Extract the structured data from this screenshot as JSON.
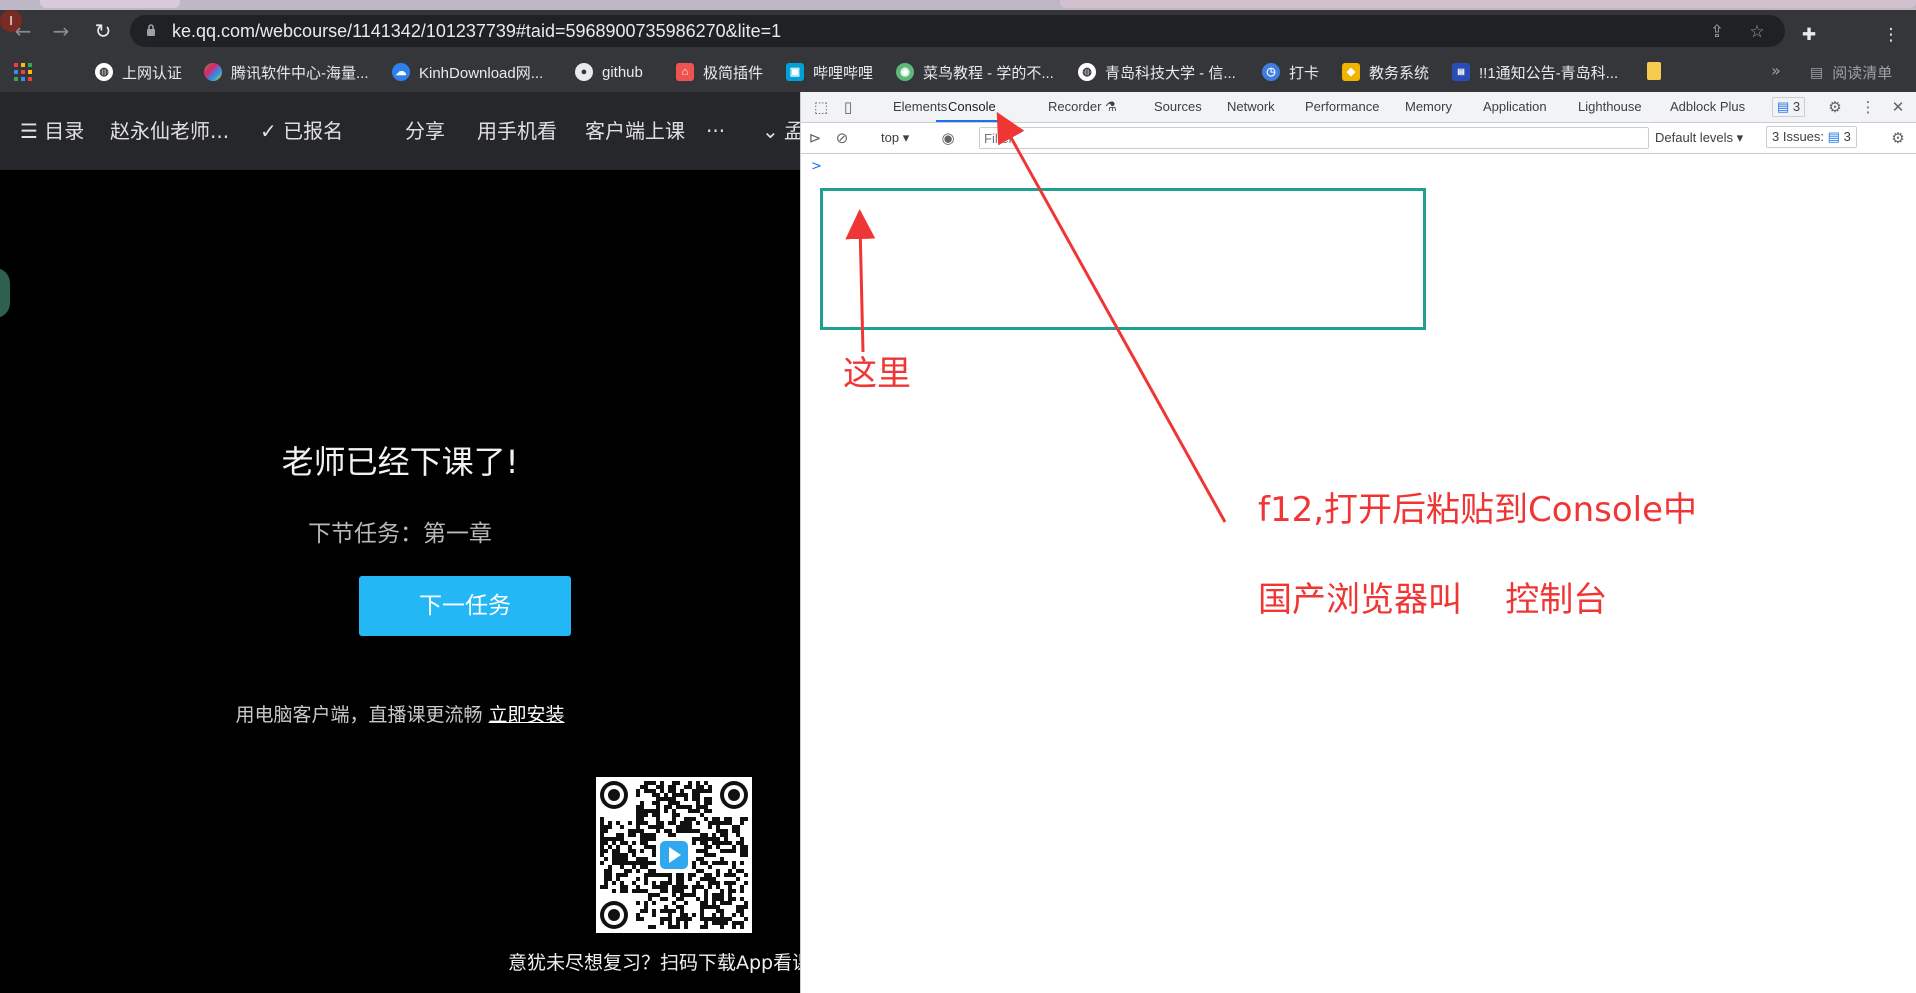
{
  "browser": {
    "url": "ke.qq.com/webcourse/1141342/101237739#taid=5968900735986270&lite=1",
    "profile_initial": "I",
    "bookmarks": [
      {
        "label": "上网认证",
        "icon": "globe-icon",
        "color": "#ffffff"
      },
      {
        "label": "腾讯软件中心-海量...",
        "icon": "clover-icon",
        "color": "#4caf50"
      },
      {
        "label": "KinhDownload网...",
        "icon": "cloud-icon",
        "color": "#2f80ed"
      },
      {
        "label": "github",
        "icon": "github-icon",
        "color": "#e8eaed"
      },
      {
        "label": "极简插件",
        "icon": "home-icon",
        "color": "#ef5350"
      },
      {
        "label": "哔哩哔哩",
        "icon": "bilibili-icon",
        "color": "#00a1d6"
      },
      {
        "label": "菜鸟教程 - 学的不...",
        "icon": "runoob-icon",
        "color": "#5fb878"
      },
      {
        "label": "青岛科技大学 - 信...",
        "icon": "globe-icon",
        "color": "#ffffff"
      },
      {
        "label": "打卡",
        "icon": "clock-icon",
        "color": "#3f7de0"
      },
      {
        "label": "教务系统",
        "icon": "cube-icon",
        "color": "#f0b400"
      },
      {
        "label": "!!1通知公告-青岛科...",
        "icon": "logo-icon",
        "color": "#2a4db5"
      }
    ],
    "reading_list": "阅读清单"
  },
  "course_page": {
    "nav": {
      "catalog": "目录",
      "teacher": "赵永仙老师...",
      "enrolled": "已报名",
      "share": "分享",
      "mobile": "用手机看",
      "client": "客户端上课",
      "more": "···",
      "cut_text": "孟"
    },
    "finished_title": "老师已经下课了!",
    "next_task": "下节任务：第一章",
    "next_button": "下一任务",
    "client_tip": "用电脑客户端，直播课更流畅",
    "install_link": "立即安装",
    "qr_caption": "意犹未尽想复习？扫码下载App看课程"
  },
  "devtools": {
    "tabs": [
      "Elements",
      "Console",
      "Recorder",
      "Sources",
      "Network",
      "Performance",
      "Memory",
      "Application",
      "Lighthouse",
      "Adblock Plus"
    ],
    "active_tab": "Console",
    "messages_count": "3",
    "context": "top",
    "filter_placeholder": "Filter",
    "levels": "Default levels",
    "issues_label": "3 Issues:",
    "issues_count": "3",
    "prompt": ">"
  },
  "annotations": {
    "here": "这里",
    "instruction1": "f12,打开后粘贴到Console中",
    "instruction2": "国产浏览器叫    控制台",
    "color": "#f03535"
  }
}
